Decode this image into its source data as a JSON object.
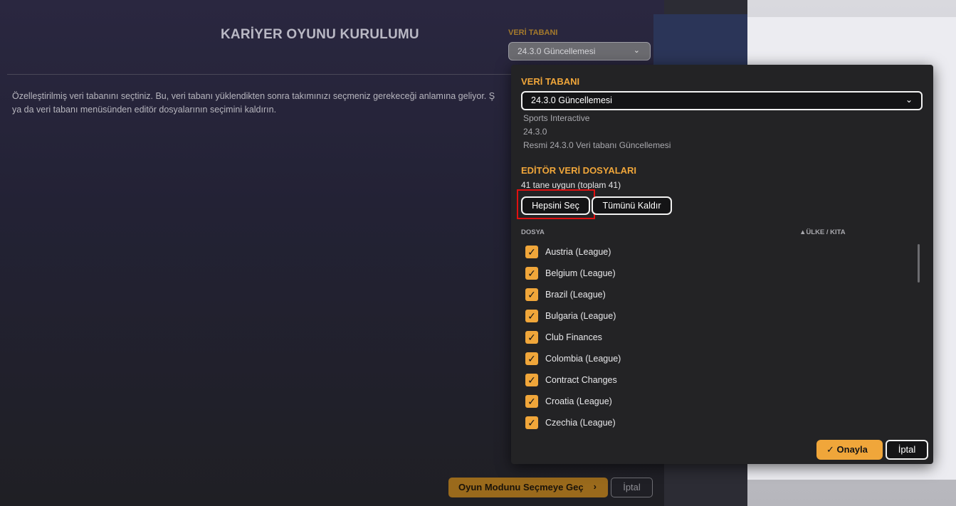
{
  "main": {
    "title": "KARİYER OYUNU KURULUMU",
    "description": "Özelleştirilmiş veri tabanını seçtiniz. Bu, veri tabanı yüklendikten sonra takımınızı seçmeniz gerekeceği anlamına geliyor. Ş\nya da veri tabanı menüsünden editör dosyalarının seçimini kaldırın.",
    "db_label": "VERİ TABANI",
    "db_value": "24.3.0 Güncellemesi",
    "next_button": "Oyun Modunu Seçmeye Geç",
    "cancel_button": "İptal"
  },
  "popup": {
    "db_title": "VERİ TABANI",
    "db_value": "24.3.0 Güncellemesi",
    "db_author": "Sports Interactive",
    "db_version": "24.3.0",
    "db_description": "Resmi 24.3.0 Veri tabanı Güncellemesi",
    "editor_title": "EDİTÖR VERİ DOSYALARI",
    "available_count": "41 tane uygun (toplam 41)",
    "select_all": "Hepsini Seç",
    "deselect_all": "Tümünü Kaldır",
    "col_file": "DOSYA",
    "col_country": "▲ÜLKE / KITA",
    "files": [
      {
        "label": "Austria (League)",
        "checked": true
      },
      {
        "label": "Belgium (League)",
        "checked": true
      },
      {
        "label": "Brazil (League)",
        "checked": true
      },
      {
        "label": "Bulgaria (League)",
        "checked": true
      },
      {
        "label": "Club Finances",
        "checked": true
      },
      {
        "label": "Colombia (League)",
        "checked": true
      },
      {
        "label": "Contract Changes",
        "checked": true
      },
      {
        "label": "Croatia (League)",
        "checked": true
      },
      {
        "label": "Czechia (League)",
        "checked": true
      }
    ],
    "confirm_button": "Onayla",
    "cancel_button": "İptal"
  },
  "colors": {
    "accent": "#f0a63a",
    "highlight": "#e01010"
  }
}
